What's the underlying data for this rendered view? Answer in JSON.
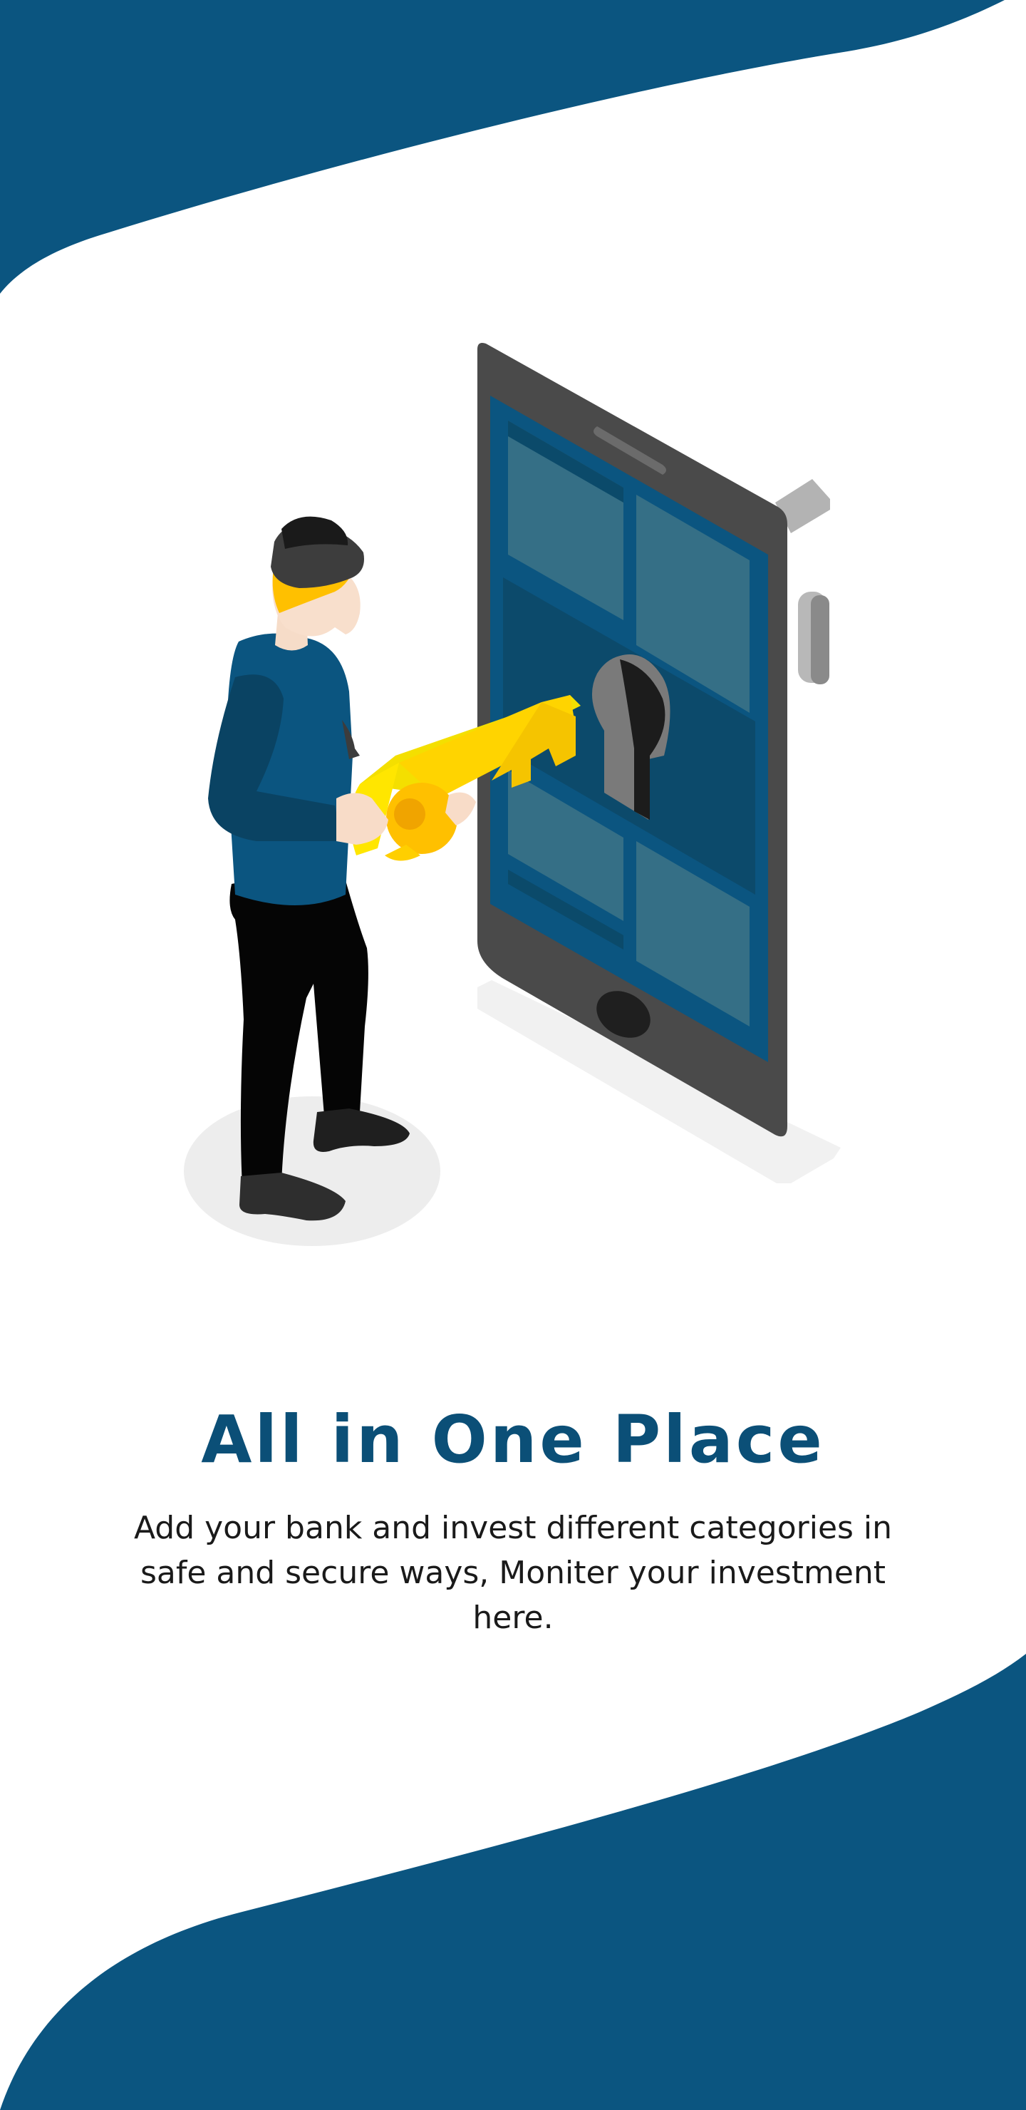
{
  "onboarding": {
    "title": "All in One Place",
    "description": "Add your bank and invest different categories in safe and secure ways, Moniter your investment here."
  },
  "colors": {
    "brand_blue": "#0b5580",
    "title_blue": "#0b4f77",
    "key_yellow": "#ffd400",
    "phone_gray": "#4a4a4a",
    "background": "#ffffff"
  },
  "illustration": {
    "icons": [
      "smartphone-lock-icon",
      "person-with-key-icon",
      "keyhole-icon",
      "key-icon"
    ]
  }
}
